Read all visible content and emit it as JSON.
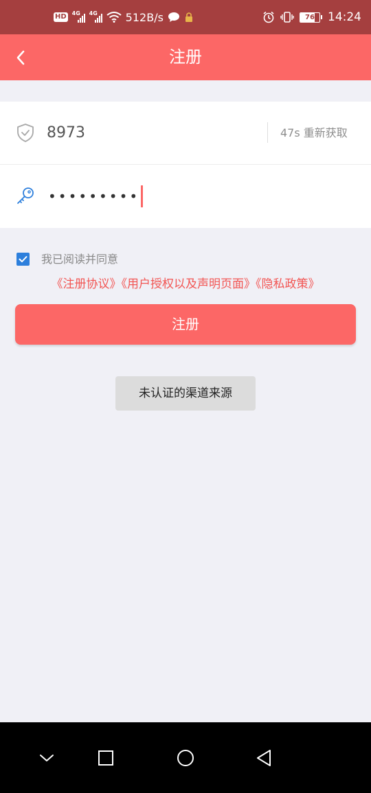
{
  "status_bar": {
    "hd_label": "HD",
    "signal_1_label": "4G",
    "signal_2_label": "4G",
    "net_speed": "512B/s",
    "battery_level": "76",
    "time": "14:24"
  },
  "header": {
    "title": "注册"
  },
  "form": {
    "code_value": "8973",
    "resend_label": "47s 重新获取",
    "password_mask": "•••••••••"
  },
  "agreement": {
    "checked": true,
    "prefix": "我已阅读并同意",
    "links": [
      "《注册协议》",
      "《用户授权以及声明页面》",
      "《隐私政策》"
    ]
  },
  "submit_label": "注册",
  "toast_text": "未认证的渠道来源",
  "colors": {
    "accent": "#fc6766",
    "status_bar": "#a53f3f",
    "checkbox": "#2d7fdc",
    "link": "#f25553"
  },
  "icons": {
    "back": "chevron-left-icon",
    "code": "shield-check-icon",
    "password": "key-icon",
    "nav_down": "chevron-down-icon",
    "nav_recent": "square-icon",
    "nav_home": "circle-icon",
    "nav_back": "triangle-back-icon"
  }
}
